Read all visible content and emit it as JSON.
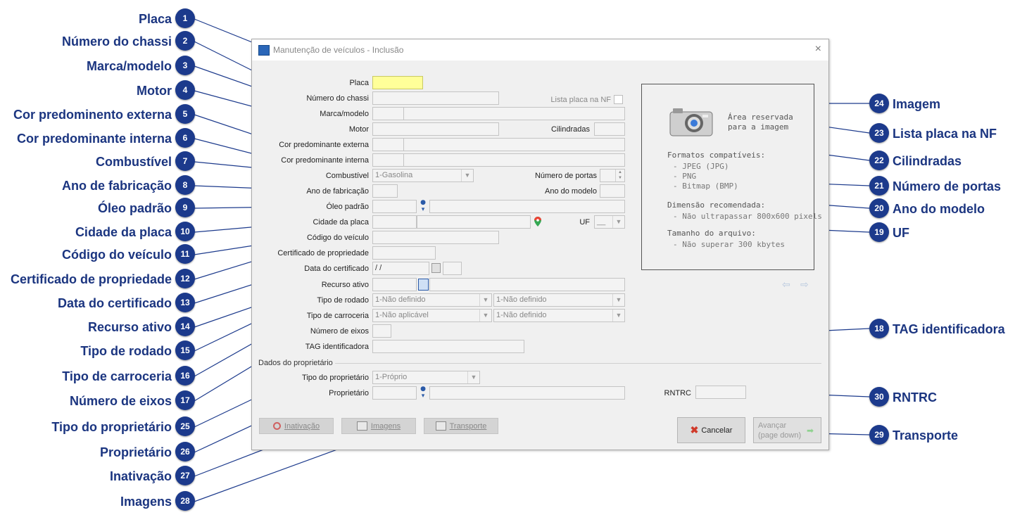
{
  "dialog": {
    "title": "Manutenção de veículos - Inclusão",
    "close_glyph": "×",
    "fields": {
      "placa": "Placa",
      "numero_chassi": "Número do chassi",
      "lista_placa_nf": "Lista placa na NF",
      "marca_modelo": "Marca/modelo",
      "motor": "Motor",
      "cilindradas": "Cilindradas",
      "cor_externa": "Cor predominante externa",
      "cor_interna": "Cor predominante interna",
      "combustivel": "Combustível",
      "combustivel_value": "1-Gasolina",
      "numero_portas": "Número de portas",
      "ano_fabricacao": "Ano de fabricação",
      "ano_modelo": "Ano do modelo",
      "oleo_padrao": "Óleo padrão",
      "cidade_placa": "Cidade da placa",
      "uf": "UF",
      "uf_value": "__",
      "codigo_veiculo": "Código do veículo",
      "certificado": "Certificado de propriedade",
      "data_certificado": "Data do certificado",
      "data_certificado_value": " / /",
      "recurso_ativo": "Recurso ativo",
      "tipo_rodado": "Tipo de rodado",
      "tipo_rodado_value1": "1-Não definido",
      "tipo_rodado_value2": "1-Não definido",
      "tipo_carroceria": "Tipo de carroceria",
      "tipo_carroceria_value1": "1-Não aplicável",
      "tipo_carroceria_value2": "1-Não definido",
      "numero_eixos": "Número de eixos",
      "tag": "TAG identificadora"
    },
    "owner_section": {
      "title": "Dados do proprietário",
      "tipo_proprietario": "Tipo do proprietário",
      "tipo_proprietario_value": "1-Próprio",
      "proprietario": "Proprietário",
      "rntrc": "RNTRC"
    },
    "image_area": {
      "reserved_line1": "Área reservada",
      "reserved_line2": "para a imagem",
      "formats_title": "Formatos compatíveis:",
      "format1": "- JPEG (JPG)",
      "format2": "- PNG",
      "format3": "- Bitmap (BMP)",
      "dimension_title": "Dimensão recomendada:",
      "dimension_value": "- Não ultrapassar 800x600 pixels",
      "size_title": "Tamanho do arquivo:",
      "size_value": "- Não superar 300 kbytes"
    },
    "buttons": {
      "inativacao": "Inativação",
      "imagens": "Imagens",
      "transporte": "Transporte",
      "cancelar": "Cancelar",
      "avancar": "Avançar",
      "avancar_sub": "(page down)"
    }
  },
  "callouts": {
    "c1": {
      "num": "1",
      "label": "Placa"
    },
    "c2": {
      "num": "2",
      "label": "Número do chassi"
    },
    "c3": {
      "num": "3",
      "label": "Marca/modelo"
    },
    "c4": {
      "num": "4",
      "label": "Motor"
    },
    "c5": {
      "num": "5",
      "label": "Cor predominento externa"
    },
    "c6": {
      "num": "6",
      "label": "Cor predominante interna"
    },
    "c7": {
      "num": "7",
      "label": "Combustível"
    },
    "c8": {
      "num": "8",
      "label": "Ano de fabricação"
    },
    "c9": {
      "num": "9",
      "label": "Óleo padrão"
    },
    "c10": {
      "num": "10",
      "label": "Cidade da placa"
    },
    "c11": {
      "num": "11",
      "label": "Código do veículo"
    },
    "c12": {
      "num": "12",
      "label": "Certificado de propriedade"
    },
    "c13": {
      "num": "13",
      "label": "Data do certificado"
    },
    "c14": {
      "num": "14",
      "label": "Recurso ativo"
    },
    "c15": {
      "num": "15",
      "label": "Tipo de rodado"
    },
    "c16": {
      "num": "16",
      "label": "Tipo de carroceria"
    },
    "c17": {
      "num": "17",
      "label": "Número de eixos"
    },
    "c25": {
      "num": "25",
      "label": "Tipo do proprietário"
    },
    "c26": {
      "num": "26",
      "label": "Proprietário"
    },
    "c27": {
      "num": "27",
      "label": "Inativação"
    },
    "c28": {
      "num": "28",
      "label": "Imagens"
    },
    "c24": {
      "num": "24",
      "label": "Imagem"
    },
    "c23": {
      "num": "23",
      "label": "Lista placa na NF"
    },
    "c22": {
      "num": "22",
      "label": "Cilindradas"
    },
    "c21": {
      "num": "21",
      "label": "Número de portas"
    },
    "c20": {
      "num": "20",
      "label": "Ano do modelo"
    },
    "c19": {
      "num": "19",
      "label": "UF"
    },
    "c18": {
      "num": "18",
      "label": "TAG identificadora"
    },
    "c30": {
      "num": "30",
      "label": "RNTRC"
    },
    "c29": {
      "num": "29",
      "label": "Transporte"
    }
  },
  "colors": {
    "badge": "#1c3a8c",
    "callout_text": "#1b3580",
    "placa_field": "#ffff99"
  }
}
